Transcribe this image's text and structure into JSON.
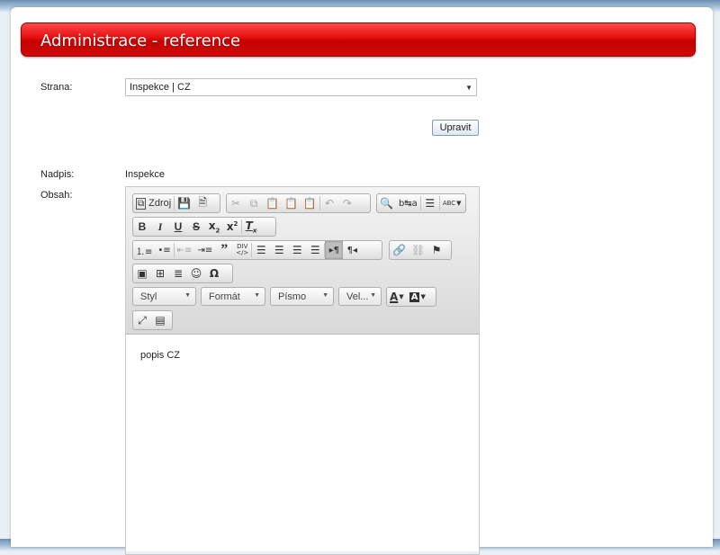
{
  "banner": {
    "title": "Administrace - reference"
  },
  "form": {
    "strana_label": "Strana:",
    "strana_value": "Inspekce | CZ",
    "upravit_label": "Upravit",
    "nadpis_label": "Nadpis:",
    "nadpis_value": "Inspekce",
    "obsah_label": "Obsah:"
  },
  "editor": {
    "toolbar": {
      "zdroj_label": "Zdroj",
      "abc_label": "ABC",
      "combos": {
        "styl": "Styl",
        "format": "Formát",
        "pismo": "Písmo",
        "velikost": "Vel..."
      }
    },
    "content": "popis CZ"
  },
  "colors": {
    "banner_red": "#e30d0d",
    "toolbar_gray": "#dcdcdc"
  }
}
